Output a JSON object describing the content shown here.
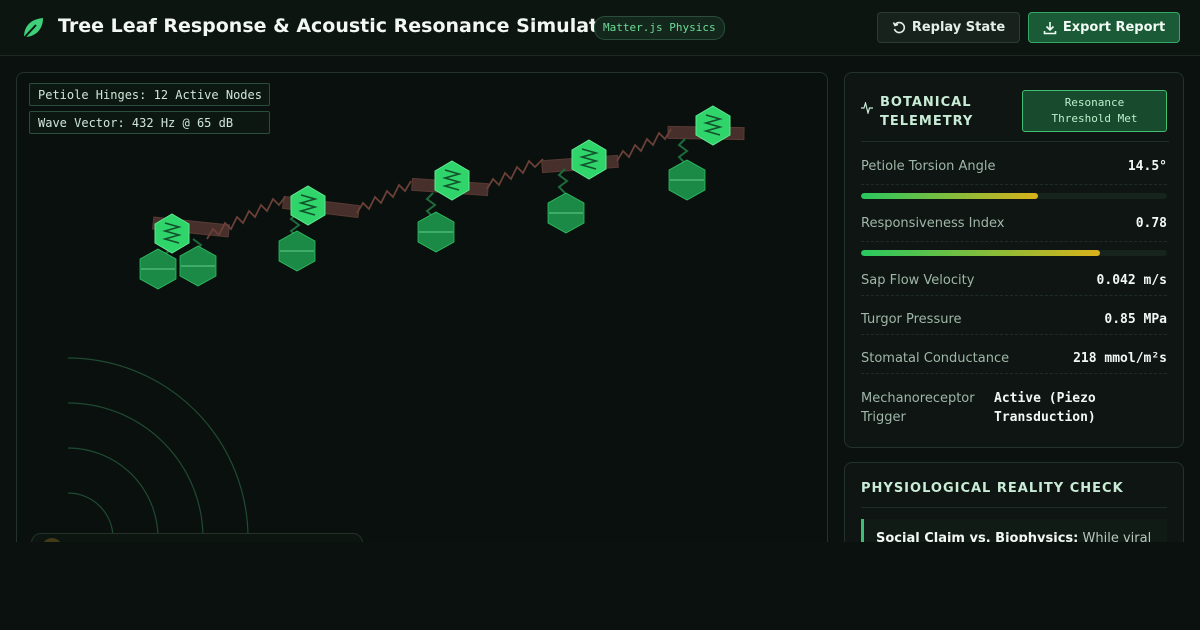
{
  "header": {
    "title": "Tree Leaf Response & Acoustic Resonance Simulator",
    "engine_badge": "Matter.js Physics",
    "replay_label": "Replay State",
    "export_label": "Export Report"
  },
  "simulation": {
    "hinges_label": "Petiole Hinges: 12 Active Nodes",
    "wave_label": "Wave Vector: 432 Hz @ 65 dB"
  },
  "telemetry": {
    "title": "BOTANICAL TELEMETRY",
    "threshold_badge_line1": "Resonance",
    "threshold_badge_line2": "Threshold Met",
    "metrics": [
      {
        "label": "Petiole Torsion Angle",
        "value": "14.5°",
        "fill": 0.58
      },
      {
        "label": "Responsiveness Index",
        "value": "0.78",
        "fill": 0.78
      },
      {
        "label": "Sap Flow Velocity",
        "value": "0.042 m/s"
      },
      {
        "label": "Turgor Pressure",
        "value": "0.85 MPa"
      },
      {
        "label": "Stomatal Conductance",
        "value": "218 mmol/m²s"
      }
    ],
    "mechanoreceptor_label": "Mechanoreceptor Trigger",
    "mechanoreceptor_value": "Active (Piezo Transduction)"
  },
  "reality_check": {
    "title": "PHYSIOLOGICAL REALITY CHECK",
    "claim_label": "Social Claim vs. Biophysics:",
    "claim_text": "While viral"
  },
  "colors": {
    "accent": "#3fbf72",
    "background": "#0b110e",
    "leaf_light": "#2fd46a",
    "leaf_dark": "#1a8a45",
    "branch": "#4a2c28"
  }
}
